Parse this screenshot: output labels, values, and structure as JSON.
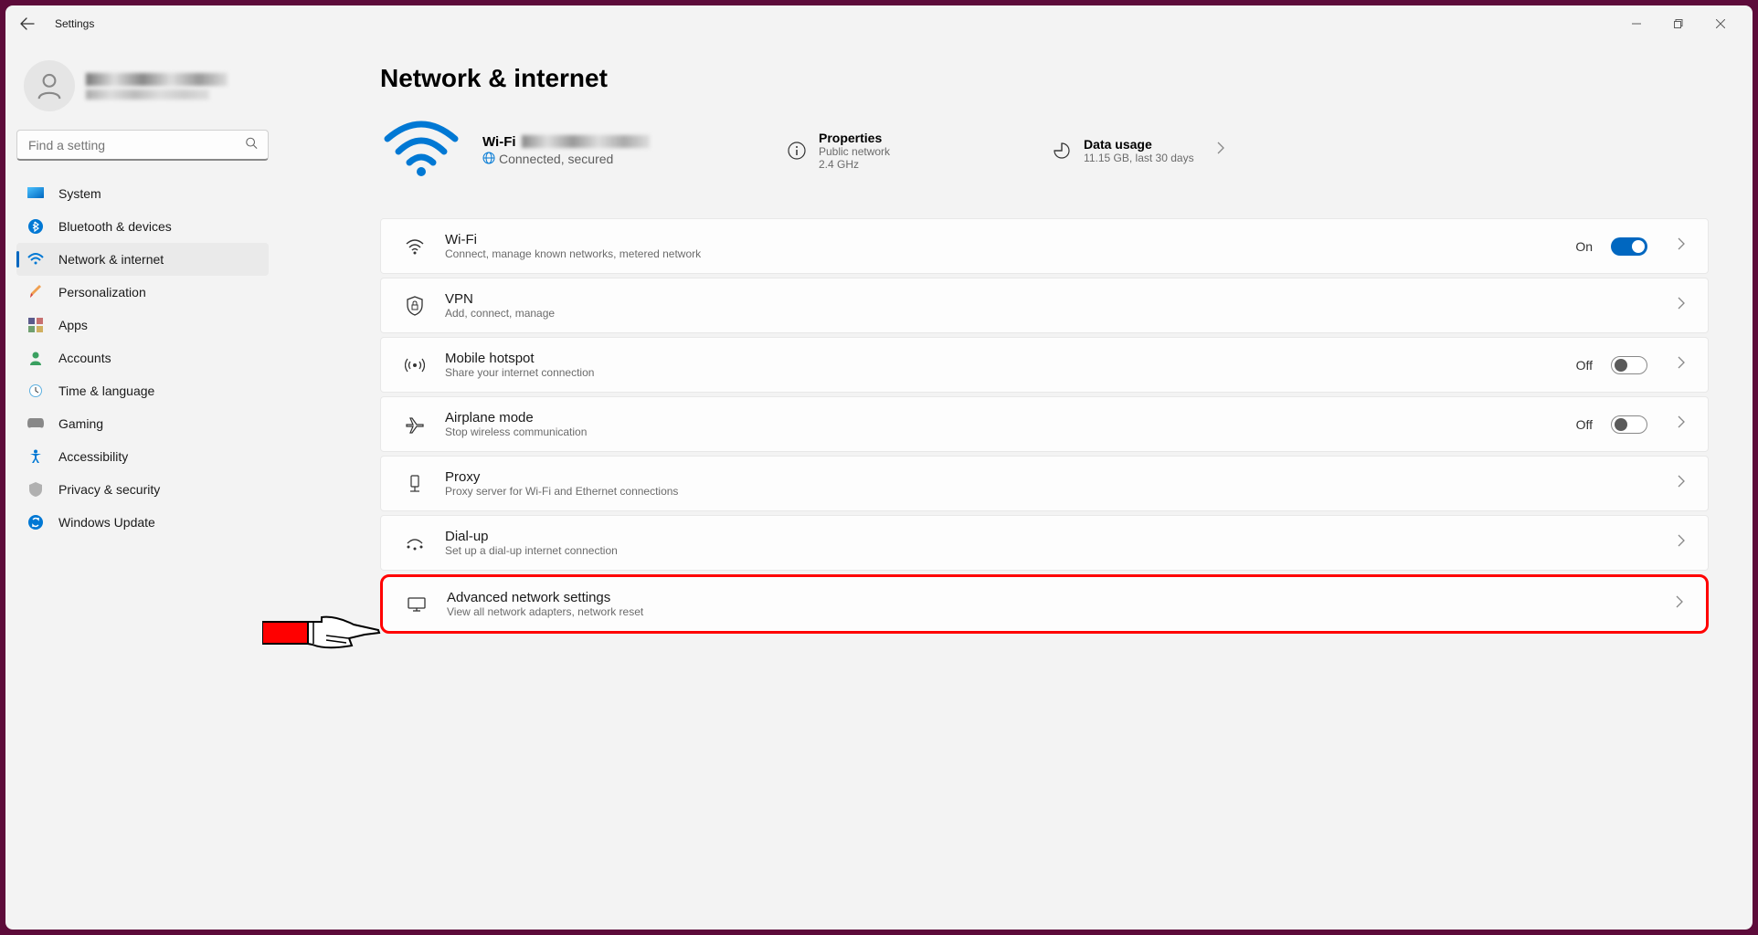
{
  "app": {
    "title": "Settings"
  },
  "search": {
    "placeholder": "Find a setting"
  },
  "nav": {
    "items": [
      {
        "label": "System"
      },
      {
        "label": "Bluetooth & devices"
      },
      {
        "label": "Network & internet"
      },
      {
        "label": "Personalization"
      },
      {
        "label": "Apps"
      },
      {
        "label": "Accounts"
      },
      {
        "label": "Time & language"
      },
      {
        "label": "Gaming"
      },
      {
        "label": "Accessibility"
      },
      {
        "label": "Privacy & security"
      },
      {
        "label": "Windows Update"
      }
    ]
  },
  "page": {
    "title": "Network & internet"
  },
  "status": {
    "wifi_label": "Wi-Fi",
    "connection": "Connected, secured",
    "props": {
      "title": "Properties",
      "line1": "Public network",
      "line2": "2.4 GHz"
    },
    "usage": {
      "title": "Data usage",
      "value": "11.15 GB, last 30 days"
    }
  },
  "settings": {
    "wifi": {
      "title": "Wi-Fi",
      "desc": "Connect, manage known networks, metered network",
      "toggle_label": "On",
      "on": true
    },
    "vpn": {
      "title": "VPN",
      "desc": "Add, connect, manage"
    },
    "hotspot": {
      "title": "Mobile hotspot",
      "desc": "Share your internet connection",
      "toggle_label": "Off",
      "on": false
    },
    "airplane": {
      "title": "Airplane mode",
      "desc": "Stop wireless communication",
      "toggle_label": "Off",
      "on": false
    },
    "proxy": {
      "title": "Proxy",
      "desc": "Proxy server for Wi-Fi and Ethernet connections"
    },
    "dialup": {
      "title": "Dial-up",
      "desc": "Set up a dial-up internet connection"
    },
    "advanced": {
      "title": "Advanced network settings",
      "desc": "View all network adapters, network reset"
    }
  }
}
